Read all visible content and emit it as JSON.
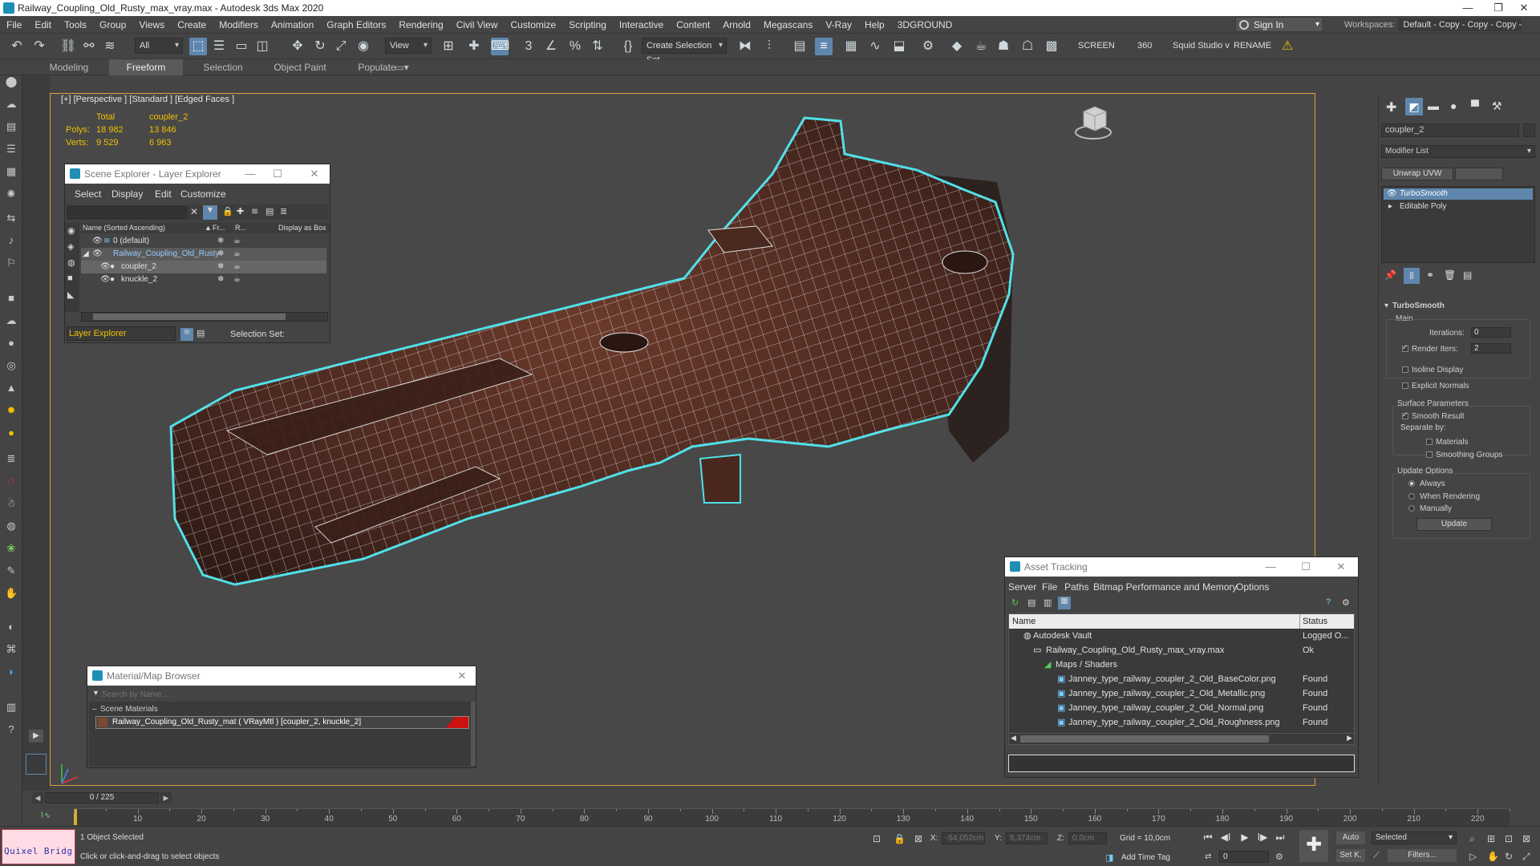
{
  "window": {
    "title": "Railway_Coupling_Old_Rusty_max_vray.max - Autodesk 3ds Max 2020"
  },
  "menu": [
    "File",
    "Edit",
    "Tools",
    "Group",
    "Views",
    "Create",
    "Modifiers",
    "Animation",
    "Graph Editors",
    "Rendering",
    "Civil View",
    "Customize",
    "Scripting",
    "Interactive",
    "Content",
    "Arnold",
    "Megascans",
    "V-Ray",
    "Help",
    "3DGROUND"
  ],
  "account": {
    "sign_in": "Sign In",
    "workspaces_label": "Workspaces:",
    "workspace_value": "Default - Copy - Copy - Copy - Copy"
  },
  "toolbar": {
    "selection_filter": "All",
    "ref_coord": "View",
    "named_selection": "Create Selection Set",
    "screen_label": "SCREEN",
    "angle_value": "360",
    "squid": "Squid Studio v",
    "rename": "RENAME"
  },
  "ribbon_tabs": [
    "Modeling",
    "Freeform",
    "Selection",
    "Object Paint",
    "Populate"
  ],
  "viewport": {
    "label": "[+] [Perspective ] [Standard ] [Edged Faces ]",
    "stats": {
      "total_label": "Total",
      "object_label": "coupler_2",
      "polys_label": "Polys:",
      "polys_total": "18 982",
      "polys_obj": "13 846",
      "verts_label": "Verts:",
      "verts_total": "9 529",
      "verts_obj": "6 963"
    }
  },
  "scene_explorer": {
    "title": "Scene Explorer - Layer Explorer",
    "menu": [
      "Select",
      "Display",
      "Edit",
      "Customize"
    ],
    "columns": [
      "Name (Sorted Ascending)",
      "Fr...",
      "R...",
      "Display as Box"
    ],
    "rows": [
      {
        "name": "0 (default)"
      },
      {
        "name": "Railway_Coupling_Old_Rusty"
      },
      {
        "name": "coupler_2"
      },
      {
        "name": "knuckle_2"
      }
    ],
    "footer_mode": "Layer Explorer",
    "selection_set_label": "Selection Set:"
  },
  "material_browser": {
    "title": "Material/Map Browser",
    "search_placeholder": "Search by Name ...",
    "group": "Scene Materials",
    "material": "Railway_Coupling_Old_Rusty_mat  ( VRayMtl )  [coupler_2, knuckle_2]",
    "material_color": "#cc1111"
  },
  "asset_tracking": {
    "title": "Asset Tracking",
    "menu": [
      "Server",
      "File",
      "Paths",
      "Bitmap Performance and Memory",
      "Options"
    ],
    "columns": [
      "Name",
      "Status"
    ],
    "rows": [
      {
        "name": "Autodesk Vault",
        "status": "Logged O..."
      },
      {
        "name": "Railway_Coupling_Old_Rusty_max_vray.max",
        "status": "Ok"
      },
      {
        "name": "Maps / Shaders",
        "status": ""
      },
      {
        "name": "Janney_type_railway_coupler_2_Old_BaseColor.png",
        "status": "Found"
      },
      {
        "name": "Janney_type_railway_coupler_2_Old_Metallic.png",
        "status": "Found"
      },
      {
        "name": "Janney_type_railway_coupler_2_Old_Normal.png",
        "status": "Found"
      },
      {
        "name": "Janney_type_railway_coupler_2_Old_Roughness.png",
        "status": "Found"
      }
    ]
  },
  "command_panel": {
    "object_name": "coupler_2",
    "modifier_list": "Modifier List",
    "unwrap_button": "Unwrap UVW",
    "stack": [
      "TurboSmooth",
      "Editable Poly"
    ],
    "rollout_title": "TurboSmooth",
    "main_label": "Main",
    "iterations_label": "Iterations:",
    "iterations_value": "0",
    "render_iters_label": "Render Iters:",
    "render_iters_value": "2",
    "isoline": "Isoline Display",
    "explicit_normals": "Explicit Normals",
    "surface_params": "Surface Parameters",
    "smooth_result": "Smooth Result",
    "separate_by": "Separate by:",
    "materials": "Materials",
    "smoothing_groups": "Smoothing Groups",
    "update_options": "Update Options",
    "always": "Always",
    "when_rendering": "When Rendering",
    "manually": "Manually",
    "update_button": "Update"
  },
  "timeline": {
    "frame_display": "0 / 225",
    "ticks": [
      "10",
      "20",
      "30",
      "40",
      "50",
      "60",
      "70",
      "80",
      "90",
      "100",
      "110",
      "120",
      "130",
      "140",
      "150",
      "160",
      "170",
      "180",
      "190",
      "200",
      "210",
      "220"
    ]
  },
  "status": {
    "quixel": "Quixel Bridg",
    "selected": "1 Object Selected",
    "prompt": "Click or click-and-drag to select objects",
    "x_label": "X:",
    "x_value": "-54,052cm",
    "y_label": "Y:",
    "y_value": "5,374cm",
    "z_label": "Z:",
    "z_value": "0,0cm",
    "grid": "Grid = 10,0cm",
    "add_time_tag": "Add Time Tag",
    "auto": "Auto",
    "selected_dd": "Selected",
    "set_k": "Set K.",
    "filters": "Filters...",
    "frame": "0"
  }
}
